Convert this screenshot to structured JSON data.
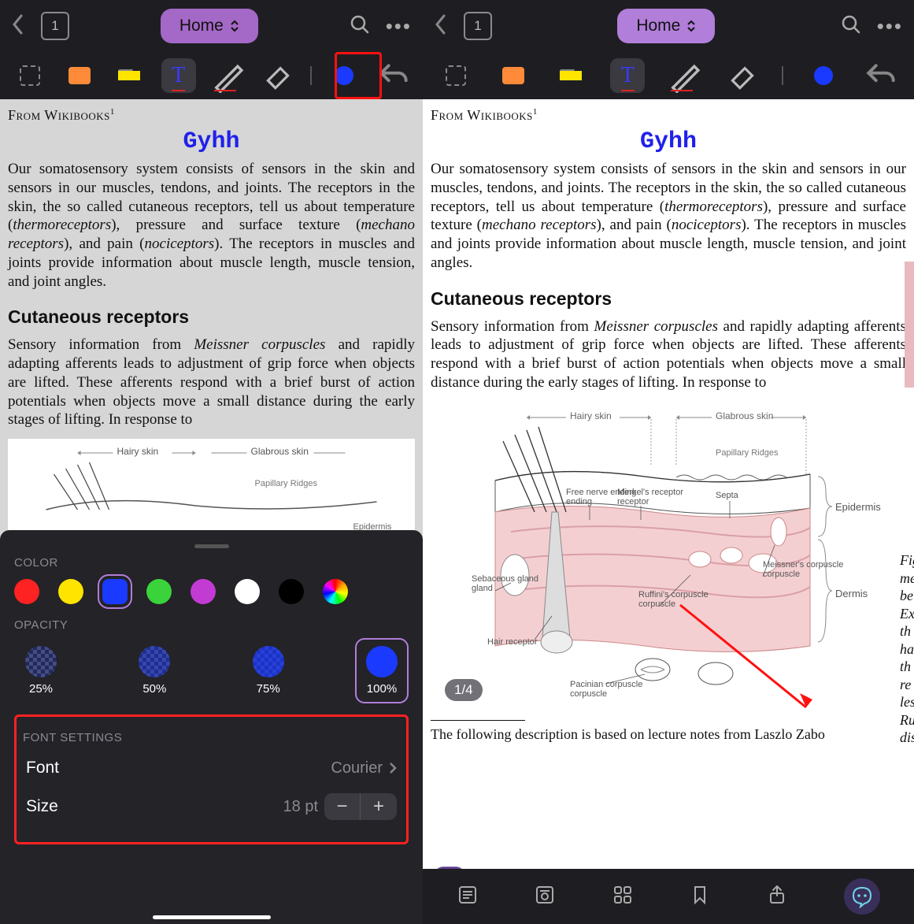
{
  "nav": {
    "page_count": "1",
    "home_label": "Home"
  },
  "doc": {
    "source": "From Wikibooks",
    "source_sup": "1",
    "gyhh": "Gyhh",
    "para_pre": "Our somatosensory system consists of sensors in the skin and sensors in our muscles, tendons, and joints. The receptors in the skin, the so called cutaneous receptors, tell us about temperature (",
    "em1": "thermoreceptors",
    "mid1": "), pressure and surface texture (",
    "em2": "mechano receptors",
    "mid2": "), and pain (",
    "em3": "nociceptors",
    "para_post": "). The receptors in muscles and joints provide information about muscle length, muscle tension, and joint angles.",
    "h3": "Cutaneous receptors",
    "p2_pre": "Sensory information from ",
    "p2_em": "Meissner corpuscles",
    "p2_post": " and rapidly adapting afferents leads to adjustment of grip force when objects are lifted. These afferents respond with a brief burst of action potentials when objects move a small distance during the early stages of lifting. In response to",
    "follow": "The following description is based on lecture notes from Laszlo Zabo",
    "page_badge": "1/4",
    "pill": "|||"
  },
  "diagram": {
    "hairy": "Hairy skin",
    "glabrous": "Glabrous skin",
    "papillary": "Papillary Ridges",
    "epidermis": "Epidermis",
    "dermis": "Dermis",
    "freenerve": "Free nerve ending",
    "merkel": "Merkel's receptor",
    "septa": "Septa",
    "meissner": "Meissner's corpuscle",
    "sebaceous": "Sebaceous gland",
    "ruffini": "Ruffini's corpuscle",
    "hairrec": "Hair receptor",
    "pacinian": "Pacinian corpuscle"
  },
  "figcap": {
    "lines": [
      "Fig",
      "me",
      "be",
      "Ex",
      "th"
    ],
    "lines_r": [
      "Fig",
      "me",
      "be",
      "Ex",
      "th",
      "ha",
      "th",
      "re",
      "les",
      "Ru",
      "dis"
    ]
  },
  "sheet": {
    "color_label": "COLOR",
    "opacity_label": "OPACITY",
    "op": [
      "25%",
      "50%",
      "75%",
      "100%"
    ],
    "font_settings": "FONT SETTINGS",
    "font_row": "Font",
    "font_val": "Courier",
    "size_row": "Size",
    "size_val": "18 pt"
  },
  "colors": {
    "red": "#ff2222",
    "yellow": "#ffe400",
    "blue": "#1a3aff",
    "green": "#3bd33b",
    "purple": "#c23bd3",
    "white": "#ffffff",
    "black": "#000000"
  }
}
